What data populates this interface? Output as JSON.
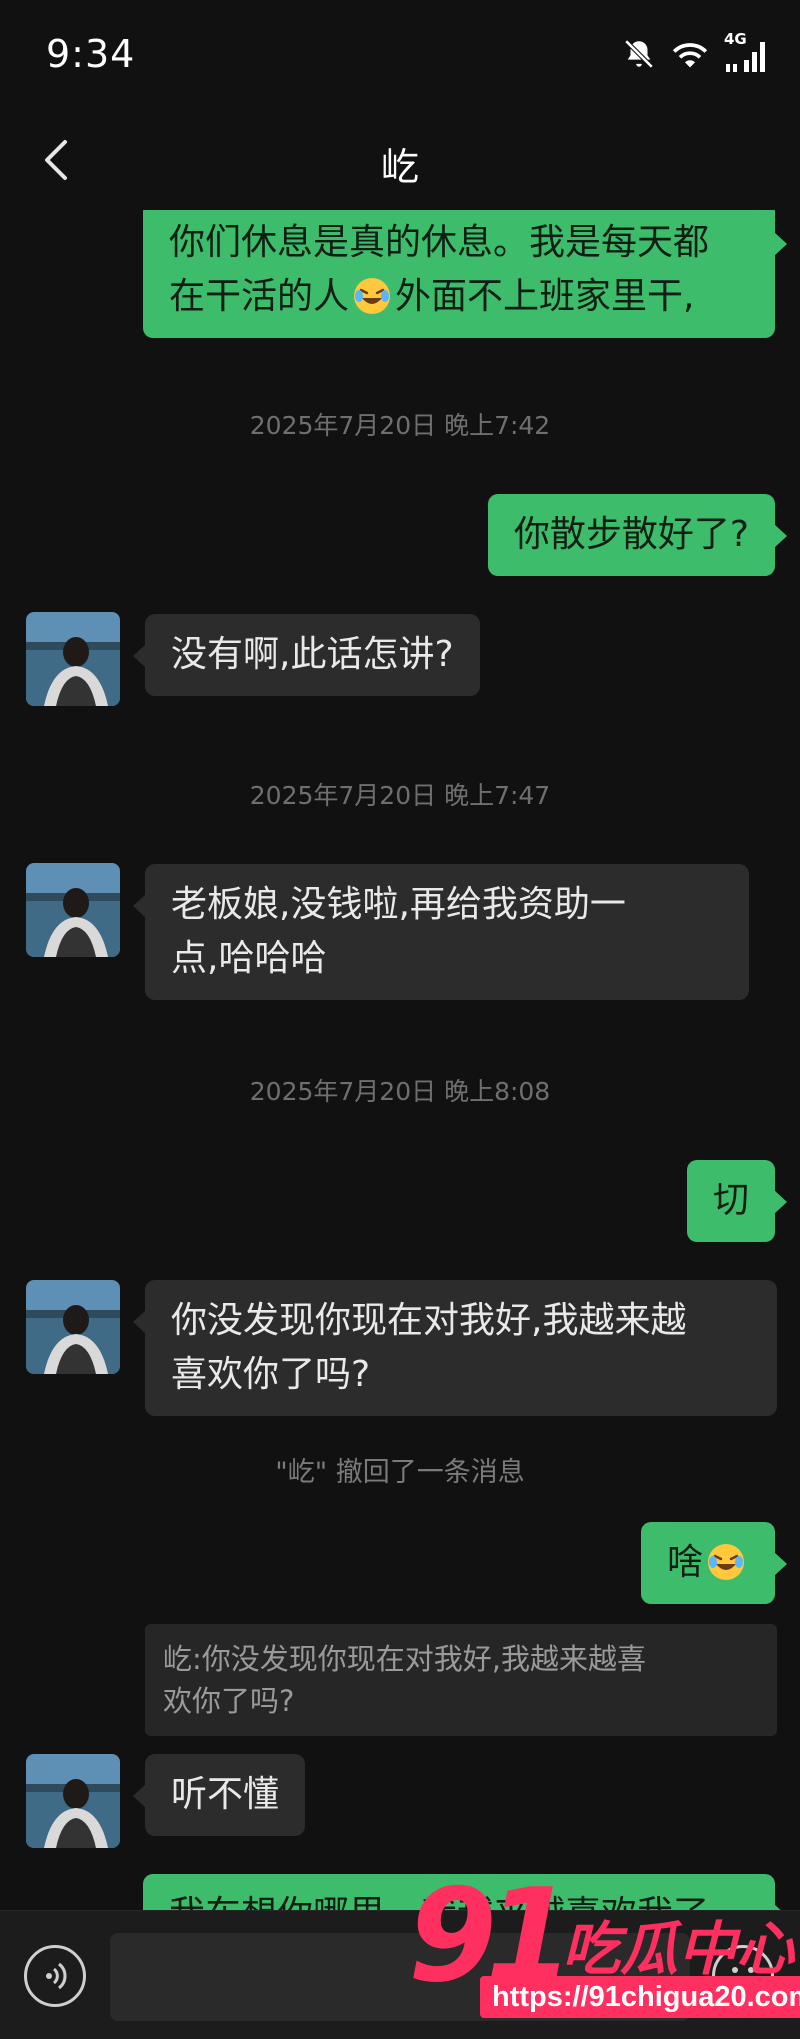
{
  "status_bar": {
    "time": "9:34",
    "network": "4G"
  },
  "nav": {
    "title": "屹"
  },
  "messages": {
    "m1": {
      "line1": "你们休息是真的休息。我是每天都",
      "line2a": "在干活的人",
      "line2b": "外面不上班家里干,",
      "emoji": "laughing-crying-emoji"
    },
    "ts1": "2025年7月20日 晚上7:42",
    "m2": "你散步散好了?",
    "m3": "没有啊,此话怎讲?",
    "ts2": "2025年7月20日 晚上7:47",
    "m4": {
      "line1": "老板娘,没钱啦,再给我资助一",
      "line2": "点,哈哈哈"
    },
    "ts3": "2025年7月20日 晚上8:08",
    "m5": "切",
    "m6": {
      "line1": "你没发现你现在对我好,我越来越",
      "line2": "喜欢你了吗?"
    },
    "recall": "\"屹\" 撤回了一条消息",
    "m7": {
      "text": "啥",
      "emoji": "laughing-crying-emoji"
    },
    "quote": {
      "line1": "屹:你没发现你现在对我好,我越来越喜",
      "line2": "欢你了吗?"
    },
    "m8": "听不懂",
    "m9": "我车想你哪里，我越来越喜欢我了"
  },
  "input": {
    "placeholder": ""
  },
  "watermark": {
    "number": "91",
    "brand": "吃瓜中心",
    "url": "https://91chigua20.com"
  },
  "colors": {
    "outgoing_bubble": "#3dbd6b",
    "incoming_bubble": "#2c2c2c",
    "background": "#111111",
    "watermark": "#ff2f5f"
  }
}
